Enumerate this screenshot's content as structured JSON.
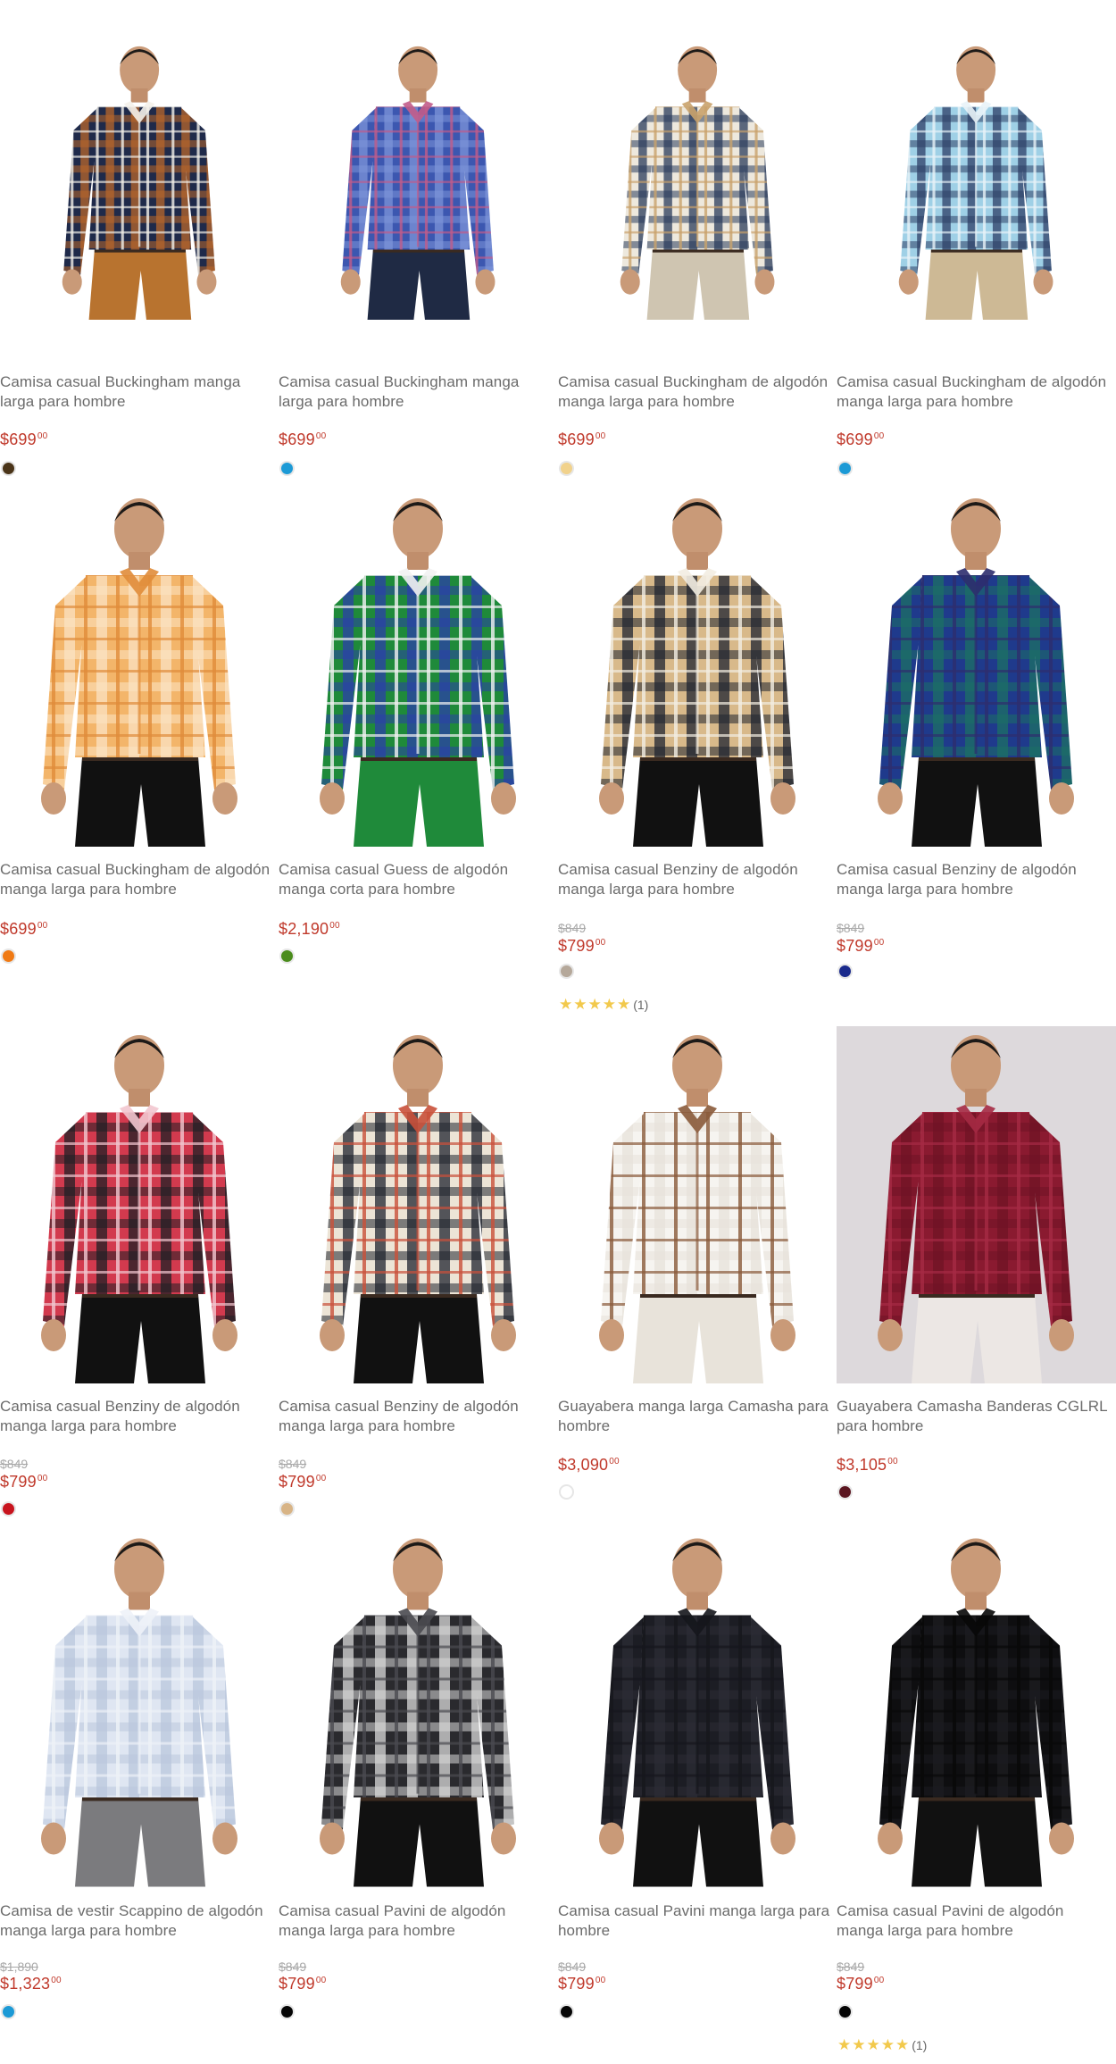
{
  "products": [
    {
      "title": "Camisa casual Buckingham manga larga para hombre",
      "old_price": "",
      "price": "$699",
      "cents": "00",
      "swatch": "#4a3418",
      "rating": "",
      "review_count": "",
      "shirt": {
        "bg": "#ffffff",
        "a": "#1f2a4a",
        "b": "#b7652a",
        "c": "#f4f1ea",
        "pants": "#b8732f"
      }
    },
    {
      "title": "Camisa casual Buckingham manga larga para hombre",
      "old_price": "",
      "price": "$699",
      "cents": "00",
      "swatch": "#1c9ad6",
      "rating": "",
      "review_count": "",
      "shirt": {
        "bg": "#ffffff",
        "a": "#3c57b0",
        "b": "#7c93d8",
        "c": "#c25c8a",
        "pants": "#1f2a44"
      }
    },
    {
      "title": "Camisa casual Buckingham de algodón manga larga para hombre",
      "old_price": "",
      "price": "$699",
      "cents": "00",
      "swatch": "#f1d28c",
      "rating": "",
      "review_count": "",
      "shirt": {
        "bg": "#ffffff",
        "a": "#ede8dd",
        "b": "#2a3c5c",
        "c": "#c9a26b",
        "pants": "#cfc5b1"
      }
    },
    {
      "title": "Camisa casual Buckingham de algodón manga larga para hombre",
      "old_price": "",
      "price": "$699",
      "cents": "00",
      "swatch": "#1c9ad6",
      "rating": "",
      "review_count": "",
      "shirt": {
        "bg": "#ffffff",
        "a": "#9fd0e6",
        "b": "#2d3f66",
        "c": "#e9f3f8",
        "pants": "#cdb995"
      }
    },
    {
      "title": "Camisa casual Buckingham de algodón manga larga para hombre",
      "old_price": "",
      "price": "$699",
      "cents": "00",
      "swatch": "#f07a14",
      "rating": "",
      "review_count": "",
      "shirt": {
        "bg": "#ffffff",
        "a": "#f3b56a",
        "b": "#fae3c2",
        "c": "#e08c3a",
        "pants": "#111111"
      }
    },
    {
      "title": "Camisa casual Guess de algodón manga corta para hombre",
      "old_price": "",
      "price": "$2,190",
      "cents": "00",
      "swatch": "#4a8c1c",
      "rating": "",
      "review_count": "",
      "shirt": {
        "bg": "#ffffff",
        "a": "#1f8a3a",
        "b": "#2a3fa8",
        "c": "#f2f2f2",
        "pants": "#1f8a3a"
      }
    },
    {
      "title": "Camisa casual Benziny de algodón manga larga para hombre",
      "old_price": "$849",
      "price": "$799",
      "cents": "00",
      "swatch": "#b5a89a",
      "rating": "★★★★★",
      "review_count": "(1)",
      "shirt": {
        "bg": "#ffffff",
        "a": "#d8b98a",
        "b": "#1e2430",
        "c": "#f3ede2",
        "pants": "#111111"
      }
    },
    {
      "title": "Camisa casual Benziny de algodón manga larga para hombre",
      "old_price": "$849",
      "price": "$799",
      "cents": "00",
      "swatch": "#1a2a8c",
      "rating": "",
      "review_count": "",
      "shirt": {
        "bg": "#ffffff",
        "a": "#1f3a8c",
        "b": "#1c6e64",
        "c": "#2d2d6e",
        "pants": "#111111"
      }
    },
    {
      "title": "Camisa casual Benziny de algodón manga larga para hombre",
      "old_price": "$849",
      "price": "$799",
      "cents": "00",
      "swatch": "#c8141e",
      "rating": "",
      "review_count": "",
      "shirt": {
        "bg": "#ffffff",
        "a": "#d23a4e",
        "b": "#1e1e24",
        "c": "#f2c7cf",
        "pants": "#111111"
      }
    },
    {
      "title": "Camisa casual Benziny de algodón manga larga para hombre",
      "old_price": "$849",
      "price": "$799",
      "cents": "00",
      "swatch": "#d8b486",
      "rating": "",
      "review_count": "",
      "shirt": {
        "bg": "#ffffff",
        "a": "#ece4d6",
        "b": "#20242e",
        "c": "#c9503a",
        "pants": "#111111"
      }
    },
    {
      "title": "Guayabera manga larga Camasha para hombre",
      "old_price": "",
      "price": "$3,090",
      "cents": "00",
      "swatch": "#ffffff",
      "rating": "",
      "review_count": "",
      "shirt": {
        "bg": "#ffffff",
        "a": "#f6f4f0",
        "b": "#e6e2da",
        "c": "#8a5a3a",
        "pants": "#e8e3da"
      }
    },
    {
      "title": "Guayabera Camasha Banderas CGLRL para hombre",
      "old_price": "",
      "price": "$3,105",
      "cents": "00",
      "swatch": "#5a1520",
      "rating": "",
      "review_count": "",
      "shirt": {
        "bg": "#ddd9dc",
        "a": "#8a1a30",
        "b": "#6e1224",
        "c": "#a52a44",
        "pants": "#ece7e4"
      }
    },
    {
      "title": "Camisa de vestir Scappino de algodón manga larga para hombre",
      "old_price": "$1,890",
      "price": "$1,323",
      "cents": "00",
      "swatch": "#1c9ad6",
      "rating": "",
      "review_count": "",
      "shirt": {
        "bg": "#ffffff",
        "a": "#dfe6f2",
        "b": "#b9c6dc",
        "c": "#eef2f8",
        "pants": "#7b7b7e"
      }
    },
    {
      "title": "Camisa casual Pavini de algodón manga larga para hombre",
      "old_price": "$849",
      "price": "$799",
      "cents": "00",
      "swatch": "#050505",
      "rating": "",
      "review_count": "",
      "shirt": {
        "bg": "#ffffff",
        "a": "#2a2a2e",
        "b": "#d8d8d8",
        "c": "#4a4a50",
        "pants": "#111111"
      }
    },
    {
      "title": "Camisa casual Pavini manga larga para hombre",
      "old_price": "$849",
      "price": "$799",
      "cents": "00",
      "swatch": "#050505",
      "rating": "",
      "review_count": "",
      "shirt": {
        "bg": "#ffffff",
        "a": "#1c1d24",
        "b": "#2b2c34",
        "c": "#15161c",
        "pants": "#111111"
      }
    },
    {
      "title": "Camisa casual Pavini de algodón manga larga para hombre",
      "old_price": "$849",
      "price": "$799",
      "cents": "00",
      "swatch": "#050505",
      "rating": "★★★★★",
      "review_count": "(1)",
      "shirt": {
        "bg": "#ffffff",
        "a": "#0e0e10",
        "b": "#1c1c20",
        "c": "#080808",
        "pants": "#111111"
      }
    }
  ]
}
